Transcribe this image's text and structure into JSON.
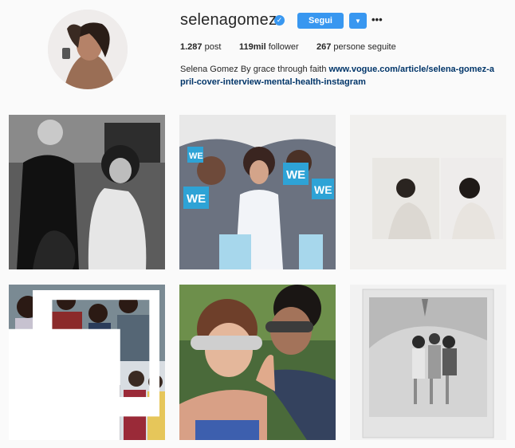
{
  "profile": {
    "username": "selenagomez",
    "verified_icon": "verified-badge-icon",
    "follow_label": "Segui",
    "dropdown_icon": "chevron-down-icon",
    "more_icon": "ellipsis-icon",
    "more_glyph": "•••",
    "stats": {
      "posts_value": "1.287",
      "posts_label": "post",
      "followers_value": "119mil",
      "followers_label": "follower",
      "following_value": "267",
      "following_label": "persone seguite"
    },
    "bio": {
      "name": "Selena Gomez",
      "text": "By grace through faith",
      "link": "www.vogue.com/article/selena-gomez-april-cover-interview-mental-health-instagram"
    }
  },
  "posts": [
    {
      "id": "post-1",
      "multi": false
    },
    {
      "id": "post-2",
      "multi": false,
      "signs": [
        "WE",
        "WE",
        "WE",
        "WE"
      ]
    },
    {
      "id": "post-3",
      "multi": false
    },
    {
      "id": "post-4",
      "multi": true
    },
    {
      "id": "post-5",
      "multi": false
    },
    {
      "id": "post-6",
      "multi": false
    }
  ],
  "colors": {
    "accent": "#3897f0",
    "link": "#003569",
    "background": "#fafafa",
    "text": "#262626",
    "we_sign": "#2ea3d6"
  }
}
